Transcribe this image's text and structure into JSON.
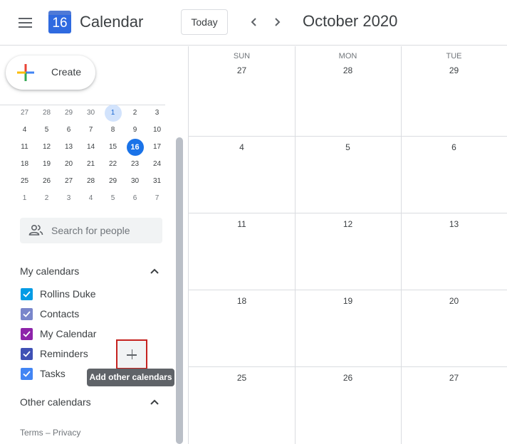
{
  "header": {
    "app_title": "Calendar",
    "logo_day": "16",
    "today_label": "Today",
    "prev_label": "‹",
    "next_label": "›",
    "month_title": "October 2020"
  },
  "sidebar": {
    "create_label": "Create",
    "mini_calendar": {
      "rows": [
        [
          "27",
          "28",
          "29",
          "30",
          "1",
          "2",
          "3"
        ],
        [
          "4",
          "5",
          "6",
          "7",
          "8",
          "9",
          "10"
        ],
        [
          "11",
          "12",
          "13",
          "14",
          "15",
          "16",
          "17"
        ],
        [
          "18",
          "19",
          "20",
          "21",
          "22",
          "23",
          "24"
        ],
        [
          "25",
          "26",
          "27",
          "28",
          "29",
          "30",
          "31"
        ],
        [
          "1",
          "2",
          "3",
          "4",
          "5",
          "6",
          "7"
        ]
      ],
      "selected": "1",
      "today": "16"
    },
    "search_placeholder": "Search for people",
    "my_calendars_title": "My calendars",
    "my_calendars": [
      {
        "label": "Rollins Duke",
        "color": "#039be5",
        "checked": true
      },
      {
        "label": "Contacts",
        "color": "#7986cb",
        "checked": true
      },
      {
        "label": "My Calendar",
        "color": "#8e24aa",
        "checked": true
      },
      {
        "label": "Reminders",
        "color": "#3f51b5",
        "checked": true
      },
      {
        "label": "Tasks",
        "color": "#4285f4",
        "checked": true
      }
    ],
    "other_calendars_title": "Other calendars",
    "add_tooltip": "Add other calendars",
    "terms_label": "Terms",
    "terms_sep": " – ",
    "privacy_label": "Privacy"
  },
  "grid": {
    "days_of_week": [
      "SUN",
      "MON",
      "TUE"
    ],
    "weeks": [
      [
        "27",
        "28",
        "29"
      ],
      [
        "4",
        "5",
        "6"
      ],
      [
        "11",
        "12",
        "13"
      ],
      [
        "18",
        "19",
        "20"
      ],
      [
        "25",
        "26",
        "27"
      ]
    ]
  }
}
